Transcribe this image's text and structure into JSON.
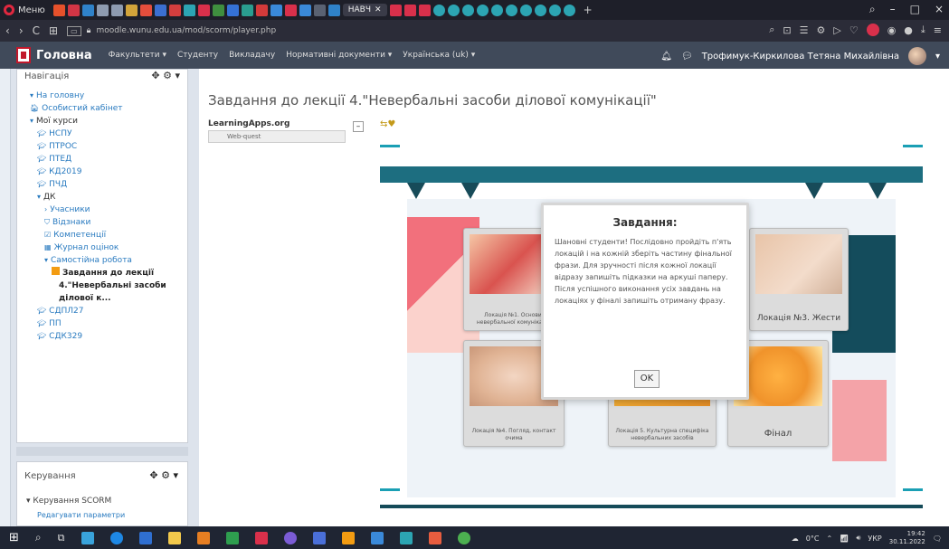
{
  "browser": {
    "menu_label": "Меню",
    "active_tab_label": "НАВЧ",
    "url": "moodle.wunu.edu.ua/mod/scorm/player.php",
    "window_controls": [
      "–",
      "□",
      "×"
    ],
    "nav": {
      "back": "‹",
      "forward": "›",
      "reload": "C"
    }
  },
  "header": {
    "site_name": "Головна",
    "nav_items": [
      "Факультети ▾",
      "Студенту",
      "Викладачу",
      "Нормативні документи ▾",
      "Українська (uk) ▾"
    ],
    "user_name": "Трофимук-Киркилова Тетяна Михайлівна",
    "bell_icon": "bell-icon",
    "chat_icon": "chat-icon"
  },
  "sidebar": {
    "nav_title": "Навігація",
    "tree": [
      {
        "label": "На головну",
        "level": 1,
        "type": "link"
      },
      {
        "label": "Особистий кабінет",
        "level": 1,
        "type": "link"
      },
      {
        "label": "Мої курси",
        "level": 1,
        "type": "dark"
      },
      {
        "label": "НСПУ",
        "level": 2,
        "type": "course"
      },
      {
        "label": "ПТРОС",
        "level": 2,
        "type": "course"
      },
      {
        "label": "ПТЕД",
        "level": 2,
        "type": "course"
      },
      {
        "label": "КД2019",
        "level": 2,
        "type": "course"
      },
      {
        "label": "ПЧД",
        "level": 2,
        "type": "course"
      },
      {
        "label": "ДК",
        "level": 2,
        "type": "dark"
      },
      {
        "label": "Учасники",
        "level": 3,
        "type": "link"
      },
      {
        "label": "Відзнаки",
        "level": 3,
        "type": "link"
      },
      {
        "label": "Компетенції",
        "level": 3,
        "type": "link"
      },
      {
        "label": "Журнал оцінок",
        "level": 3,
        "type": "link"
      },
      {
        "label": "Самостійна робота",
        "level": 3,
        "type": "link"
      },
      {
        "label": "Завдання до лекції",
        "level": 4,
        "type": "selected"
      },
      {
        "label": "4.\"Невербальні засоби",
        "level": 4,
        "type": "selected"
      },
      {
        "label": "ділової к...",
        "level": 4,
        "type": "selected"
      },
      {
        "label": "СДПЛ27",
        "level": 2,
        "type": "course"
      },
      {
        "label": "ПП",
        "level": 2,
        "type": "course"
      },
      {
        "label": "СДК329",
        "level": 2,
        "type": "course"
      }
    ],
    "scorm_title": "Керування",
    "scorm_item": "Керування SCORM",
    "scorm_sub": "Редагувати параметри"
  },
  "main": {
    "title": "Завдання до лекції 4.\"Невербальні засоби ділової комунікації\"",
    "la_name": "LearningApps.org",
    "la_bar": "Web-quest",
    "la_toggle": "–"
  },
  "game": {
    "cards": [
      {
        "caption": "Локація №1. Основи невербальної комунікації"
      },
      {
        "caption": "Локація №3. Жести"
      },
      {
        "caption": "Локація №4. Погляд, контакт очима"
      },
      {
        "caption": "Локація 5. Культурна специфіка невербальних засобів"
      },
      {
        "caption": "Фінал"
      }
    ],
    "modal": {
      "title": "Завдання:",
      "text": "Шановні студенти! Послідовно пройдіть п'ять локацій і на кожній зберіть частину фінальної фрази. Для зручності після кожної локації відразу запишіть підказки на аркуші паперу. Після успішного виконання усіх завдань на локаціях у фіналі запишіть отриману фразу.",
      "ok_label": "OK"
    }
  },
  "taskbar": {
    "temperature": "0°C",
    "lang": "УКР",
    "time": "19:42",
    "date": "30.11.2022"
  },
  "colors": {
    "accent_teal": "#1a9fb4",
    "banner": "#1d6e80",
    "header_bg": "#404a5a",
    "brand_red": "#c2182b"
  }
}
